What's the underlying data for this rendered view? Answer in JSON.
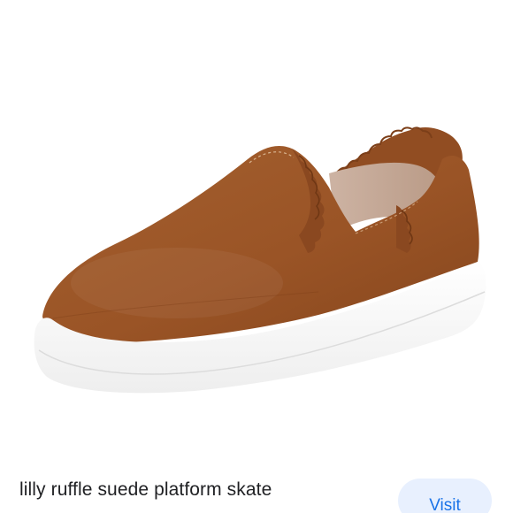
{
  "product": {
    "image_icon": "brown-suede-ruffle-slip-on-sneaker",
    "title": "lilly ruffle suede platform skate"
  },
  "actions": {
    "visit_label": "Visit"
  },
  "colors": {
    "suede": "#9c5527",
    "sole": "#fbfbfb",
    "button_bg": "#e8f0fe",
    "button_text": "#1a73e8",
    "title_text": "#202124"
  }
}
